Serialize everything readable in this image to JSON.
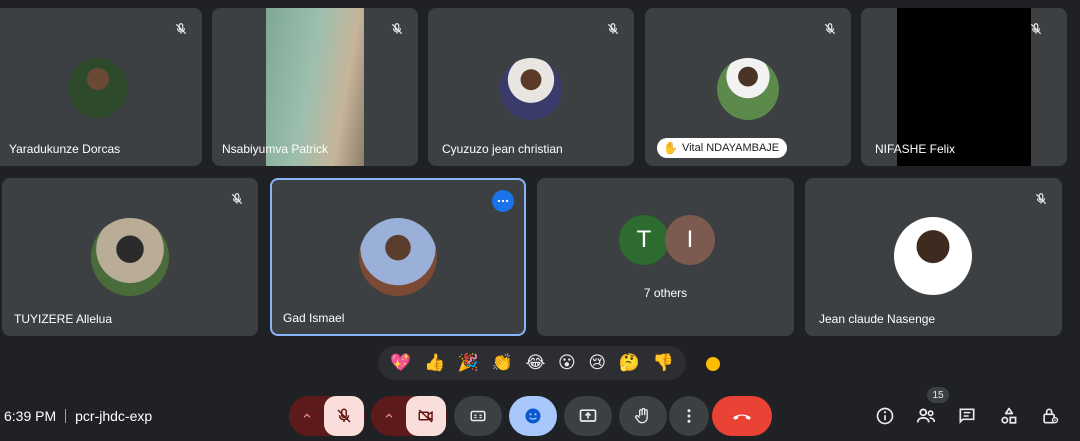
{
  "tiles": {
    "t1": {
      "name": "Yaradukunze Dorcas"
    },
    "t2": {
      "name": "Nsabiyumva Patrick"
    },
    "t3": {
      "name": "Cyuzuzo jean christian"
    },
    "t4": {
      "name": "Vital NDAYAMBAJE"
    },
    "t5": {
      "name": "NIFASHE Felix"
    },
    "t6": {
      "name": "TUYIZERE Allelua"
    },
    "t7": {
      "name": "Gad Ismael"
    },
    "t8": {
      "name": "7 others",
      "letters": [
        "T",
        "I"
      ]
    },
    "t9": {
      "name": "Jean claude Nasenge"
    }
  },
  "reactions": [
    "💖",
    "👍",
    "🎉",
    "👏",
    "😂",
    "😮",
    "😢",
    "🤔",
    "👎"
  ],
  "footer": {
    "time": "6:39 PM",
    "meeting_code": "pcr-jhdc-exp",
    "people_count": "15"
  },
  "colors": {
    "background": "#202124",
    "tile": "#3c4043",
    "accent_blue": "#8ab4f8",
    "end_call": "#ea4335",
    "muted_group": "#5c1a1a",
    "letter_t": "#2e6b2e",
    "letter_i": "#7d5a4f"
  },
  "icons": {
    "mic_off": "mic-off-icon",
    "camera_off": "camera-off-icon",
    "captions": "captions-icon",
    "emoji": "emoji-icon",
    "present": "present-screen-icon",
    "raise_hand": "raise-hand-icon",
    "more": "more-vert-icon",
    "end_call": "end-call-icon",
    "info": "info-icon",
    "people": "people-icon",
    "chat": "chat-icon",
    "activities": "activities-icon",
    "host_controls": "host-controls-icon"
  }
}
